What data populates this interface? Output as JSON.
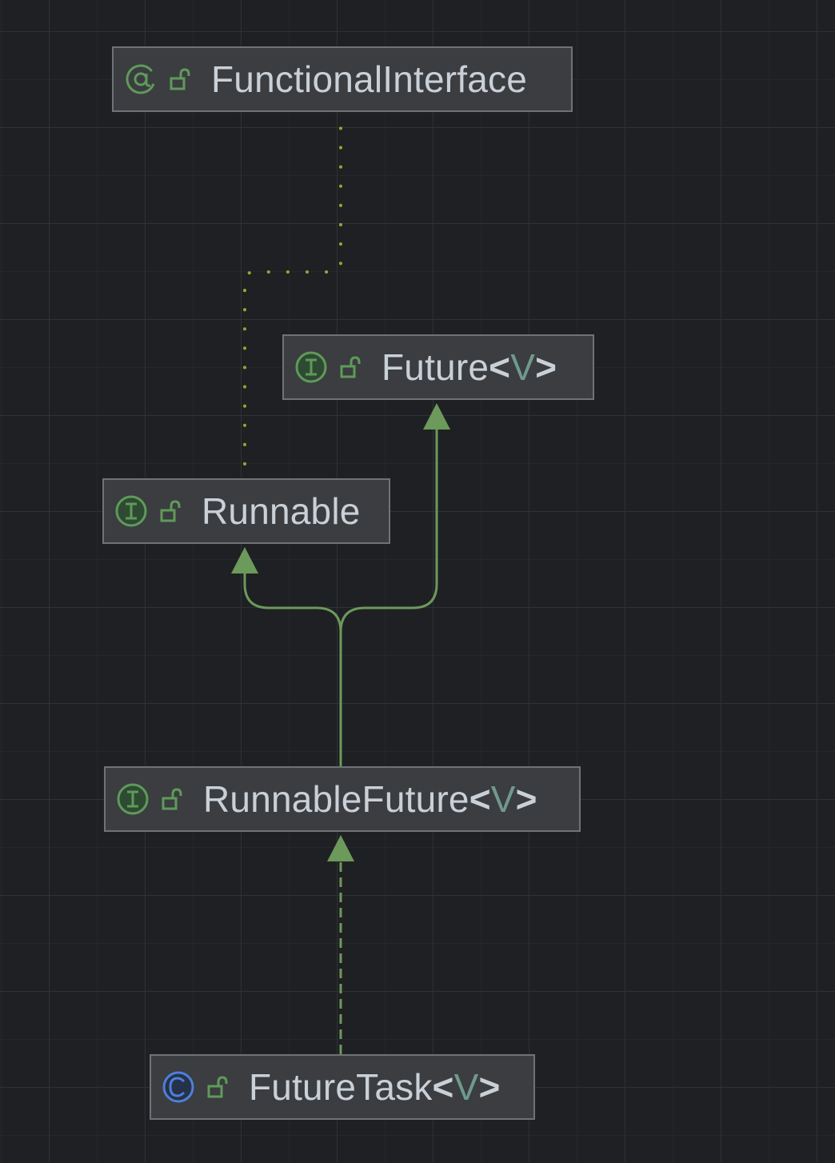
{
  "diagram": {
    "nodes": [
      {
        "id": "functional-interface",
        "kind": "annotation",
        "kind_icon": "at-sign-icon",
        "access_icon": "unlock-icon",
        "name": "FunctionalInterface",
        "type_param": ""
      },
      {
        "id": "future",
        "kind": "interface",
        "kind_icon": "interface-icon",
        "access_icon": "unlock-icon",
        "name": "Future",
        "type_param": "V"
      },
      {
        "id": "runnable",
        "kind": "interface",
        "kind_icon": "interface-icon",
        "access_icon": "unlock-icon",
        "name": "Runnable",
        "type_param": ""
      },
      {
        "id": "runnable-future",
        "kind": "interface",
        "kind_icon": "interface-icon",
        "access_icon": "unlock-icon",
        "name": "RunnableFuture",
        "type_param": "V"
      },
      {
        "id": "future-task",
        "kind": "class",
        "kind_icon": "class-icon",
        "access_icon": "unlock-icon",
        "name": "FutureTask",
        "type_param": "V"
      }
    ],
    "edges": [
      {
        "from": "runnable",
        "to": "functional-interface",
        "style": "dotted",
        "color": "#a0a030"
      },
      {
        "from": "runnable-future",
        "to": "runnable",
        "style": "solid",
        "color": "#6b9a5b"
      },
      {
        "from": "runnable-future",
        "to": "future",
        "style": "solid",
        "color": "#6b9a5b"
      },
      {
        "from": "future-task",
        "to": "runnable-future",
        "style": "dashed",
        "color": "#6b9a5b"
      }
    ],
    "colors": {
      "background": "#1f2023",
      "node_fill": "#3b3d40",
      "node_border": "#6f7276",
      "label_text": "#c9d0d8",
      "type_param": "#6f9a8c",
      "icon_green": "#5f9a5a",
      "class_icon_blue": "#4f7fd9",
      "extends_arrow": "#6b9a5b",
      "annotation_link": "#a0a030"
    }
  }
}
